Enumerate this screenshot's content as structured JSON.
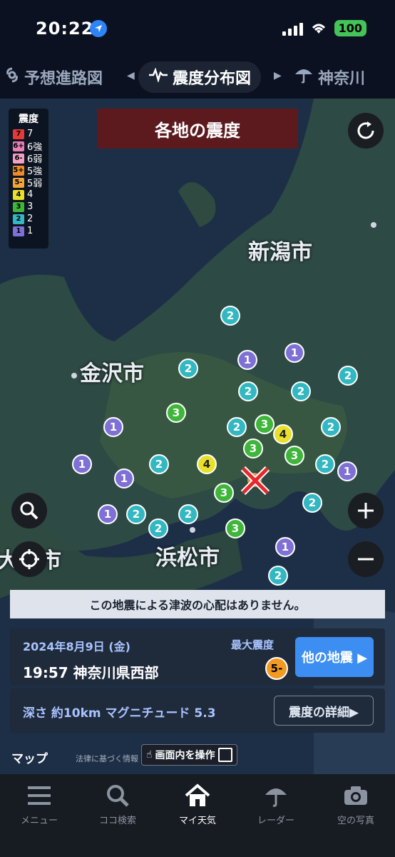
{
  "status": {
    "time": "20:22",
    "battery": "100"
  },
  "tabs": {
    "left": "予想進路図",
    "center": "震度分布図",
    "right": "神奈川"
  },
  "legend": {
    "title": "震度",
    "items": [
      {
        "badge": "7",
        "label": "7",
        "color": "#e53935"
      },
      {
        "badge": "6+",
        "label": "6強",
        "color": "#e87fb6"
      },
      {
        "badge": "6-",
        "label": "6弱",
        "color": "#f1a1c4"
      },
      {
        "badge": "5+",
        "label": "5強",
        "color": "#f08b2a"
      },
      {
        "badge": "5-",
        "label": "5弱",
        "color": "#f3a43a"
      },
      {
        "badge": "4",
        "label": "4",
        "color": "#e8e02a"
      },
      {
        "badge": "3",
        "label": "3",
        "color": "#3fb63b"
      },
      {
        "badge": "2",
        "label": "2",
        "color": "#33b8c2"
      },
      {
        "badge": "1",
        "label": "1",
        "color": "#7f70d6"
      }
    ]
  },
  "banner": "各地の震度",
  "cities": {
    "niigata": "新潟市",
    "kanazawa": "金沢市",
    "hamamatsu": "浜松市",
    "osaka": "大阪市"
  },
  "markers": [
    "2",
    "1",
    "1",
    "2",
    "2",
    "2",
    "2",
    "3",
    "1",
    "3",
    "2",
    "2",
    "4",
    "1",
    "2",
    "1",
    "4",
    "3",
    "3",
    "2",
    "1",
    "3",
    "2",
    "1",
    "2",
    "2",
    "3",
    "2",
    "1",
    "2"
  ],
  "tsunami": "この地震による津波の心配はありません。",
  "quake": {
    "date": "2024年8月9日 (金)",
    "time_place": "19:57 神奈川県西部",
    "max_label": "最大震度",
    "max_value": "5-",
    "other_button": "他の地震 ▶",
    "depth_mag": "深さ 約10km マグニチュード 5.3",
    "detail_button": "震度の詳細▶"
  },
  "map_footer": {
    "attribution": "マップ",
    "legal": "法律に基づく情報",
    "operate": "画面内を操作"
  },
  "nav": [
    {
      "label": "メニュー"
    },
    {
      "label": "ココ検索"
    },
    {
      "label": "マイ天気"
    },
    {
      "label": "レーダー"
    },
    {
      "label": "空の写真"
    }
  ]
}
